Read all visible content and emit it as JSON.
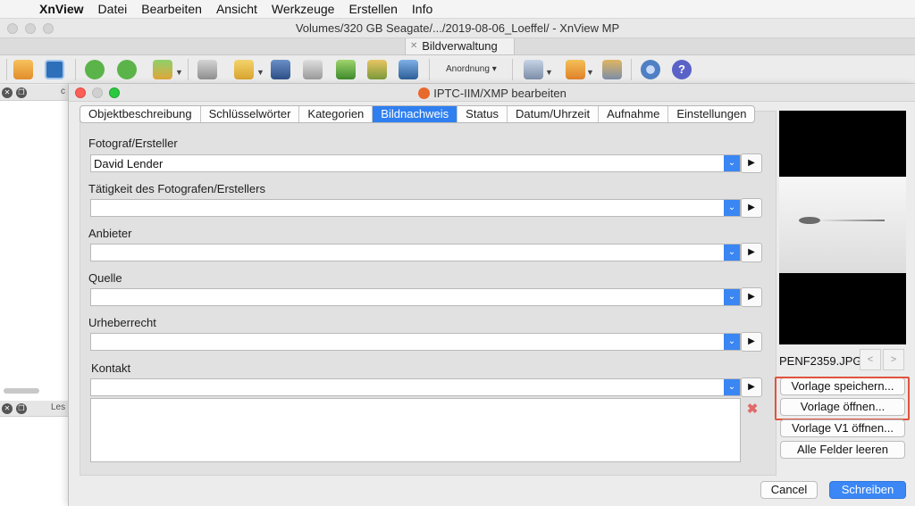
{
  "menubar": {
    "apple": "",
    "app": "XnView",
    "items": [
      "Datei",
      "Bearbeiten",
      "Ansicht",
      "Werkzeuge",
      "Erstellen",
      "Info"
    ]
  },
  "main_window": {
    "title": "Volumes/320 GB Seagate/.../2019-08-06_Loeffel/ - XnView MP",
    "tab": "Bildverwaltung"
  },
  "toolbar": {
    "anordnung": "Anordnung",
    "icons": [
      "scan-icon",
      "fullscreen-icon",
      "rotate-left-icon",
      "rotate-right-icon",
      "convert-icon",
      "lock-icon",
      "export-icon",
      "binoculars-icon",
      "print-icon",
      "compare-icon",
      "slideshow-icon",
      "capture-icon",
      "view-icon",
      "bookmark-icon",
      "hierarchy-icon",
      "settings-icon",
      "help-icon"
    ]
  },
  "left_panel": {
    "top_label": "c",
    "bottom_label": "Les"
  },
  "dialog": {
    "title": "IPTC-IIM/XMP bearbeiten",
    "tabs": [
      {
        "label": "Objektbeschreibung",
        "active": false
      },
      {
        "label": "Schlüsselwörter",
        "active": false
      },
      {
        "label": "Kategorien",
        "active": false
      },
      {
        "label": "Bildnachweis",
        "active": true
      },
      {
        "label": "Status",
        "active": false
      },
      {
        "label": "Datum/Uhrzeit",
        "active": false
      },
      {
        "label": "Aufnahme",
        "active": false
      },
      {
        "label": "Einstellungen",
        "active": false
      }
    ],
    "fields": [
      {
        "label": "Fotograf/Ersteller",
        "value": "David Lender"
      },
      {
        "label": "Tätigkeit des Fotografen/Erstellers",
        "value": ""
      },
      {
        "label": "Anbieter",
        "value": ""
      },
      {
        "label": "Quelle",
        "value": ""
      },
      {
        "label": "Urheberrecht",
        "value": ""
      },
      {
        "label": "Kontakt",
        "value": ""
      }
    ],
    "arrow_symbol": "▶",
    "dropdown_symbol": "⌄",
    "preview": {
      "filename": "PENF2359.JPG",
      "prev": "<",
      "next": ">"
    },
    "side_buttons": {
      "save_template": "Vorlage speichern...",
      "open_template": "Vorlage öffnen...",
      "open_v1_template": "Vorlage V1 öffnen...",
      "clear_all": "Alle Felder leeren"
    },
    "cancel": "Cancel",
    "submit": "Schreiben"
  },
  "colors": {
    "accent": "#2f7ff0",
    "highlight_box": "#e0533d",
    "close_light": "#fc5f57",
    "minimize_light": "#d0d0d0",
    "zoom_light": "#2ac940"
  }
}
